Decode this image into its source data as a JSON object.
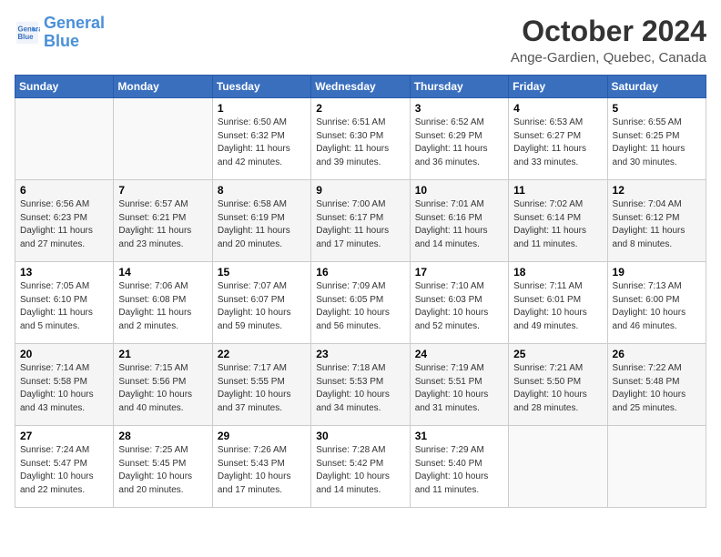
{
  "header": {
    "logo_line1": "General",
    "logo_line2": "Blue",
    "title": "October 2024",
    "subtitle": "Ange-Gardien, Quebec, Canada"
  },
  "days_of_week": [
    "Sunday",
    "Monday",
    "Tuesday",
    "Wednesday",
    "Thursday",
    "Friday",
    "Saturday"
  ],
  "weeks": [
    [
      {
        "day": "",
        "info": ""
      },
      {
        "day": "",
        "info": ""
      },
      {
        "day": "1",
        "info": "Sunrise: 6:50 AM\nSunset: 6:32 PM\nDaylight: 11 hours and 42 minutes."
      },
      {
        "day": "2",
        "info": "Sunrise: 6:51 AM\nSunset: 6:30 PM\nDaylight: 11 hours and 39 minutes."
      },
      {
        "day": "3",
        "info": "Sunrise: 6:52 AM\nSunset: 6:29 PM\nDaylight: 11 hours and 36 minutes."
      },
      {
        "day": "4",
        "info": "Sunrise: 6:53 AM\nSunset: 6:27 PM\nDaylight: 11 hours and 33 minutes."
      },
      {
        "day": "5",
        "info": "Sunrise: 6:55 AM\nSunset: 6:25 PM\nDaylight: 11 hours and 30 minutes."
      }
    ],
    [
      {
        "day": "6",
        "info": "Sunrise: 6:56 AM\nSunset: 6:23 PM\nDaylight: 11 hours and 27 minutes."
      },
      {
        "day": "7",
        "info": "Sunrise: 6:57 AM\nSunset: 6:21 PM\nDaylight: 11 hours and 23 minutes."
      },
      {
        "day": "8",
        "info": "Sunrise: 6:58 AM\nSunset: 6:19 PM\nDaylight: 11 hours and 20 minutes."
      },
      {
        "day": "9",
        "info": "Sunrise: 7:00 AM\nSunset: 6:17 PM\nDaylight: 11 hours and 17 minutes."
      },
      {
        "day": "10",
        "info": "Sunrise: 7:01 AM\nSunset: 6:16 PM\nDaylight: 11 hours and 14 minutes."
      },
      {
        "day": "11",
        "info": "Sunrise: 7:02 AM\nSunset: 6:14 PM\nDaylight: 11 hours and 11 minutes."
      },
      {
        "day": "12",
        "info": "Sunrise: 7:04 AM\nSunset: 6:12 PM\nDaylight: 11 hours and 8 minutes."
      }
    ],
    [
      {
        "day": "13",
        "info": "Sunrise: 7:05 AM\nSunset: 6:10 PM\nDaylight: 11 hours and 5 minutes."
      },
      {
        "day": "14",
        "info": "Sunrise: 7:06 AM\nSunset: 6:08 PM\nDaylight: 11 hours and 2 minutes."
      },
      {
        "day": "15",
        "info": "Sunrise: 7:07 AM\nSunset: 6:07 PM\nDaylight: 10 hours and 59 minutes."
      },
      {
        "day": "16",
        "info": "Sunrise: 7:09 AM\nSunset: 6:05 PM\nDaylight: 10 hours and 56 minutes."
      },
      {
        "day": "17",
        "info": "Sunrise: 7:10 AM\nSunset: 6:03 PM\nDaylight: 10 hours and 52 minutes."
      },
      {
        "day": "18",
        "info": "Sunrise: 7:11 AM\nSunset: 6:01 PM\nDaylight: 10 hours and 49 minutes."
      },
      {
        "day": "19",
        "info": "Sunrise: 7:13 AM\nSunset: 6:00 PM\nDaylight: 10 hours and 46 minutes."
      }
    ],
    [
      {
        "day": "20",
        "info": "Sunrise: 7:14 AM\nSunset: 5:58 PM\nDaylight: 10 hours and 43 minutes."
      },
      {
        "day": "21",
        "info": "Sunrise: 7:15 AM\nSunset: 5:56 PM\nDaylight: 10 hours and 40 minutes."
      },
      {
        "day": "22",
        "info": "Sunrise: 7:17 AM\nSunset: 5:55 PM\nDaylight: 10 hours and 37 minutes."
      },
      {
        "day": "23",
        "info": "Sunrise: 7:18 AM\nSunset: 5:53 PM\nDaylight: 10 hours and 34 minutes."
      },
      {
        "day": "24",
        "info": "Sunrise: 7:19 AM\nSunset: 5:51 PM\nDaylight: 10 hours and 31 minutes."
      },
      {
        "day": "25",
        "info": "Sunrise: 7:21 AM\nSunset: 5:50 PM\nDaylight: 10 hours and 28 minutes."
      },
      {
        "day": "26",
        "info": "Sunrise: 7:22 AM\nSunset: 5:48 PM\nDaylight: 10 hours and 25 minutes."
      }
    ],
    [
      {
        "day": "27",
        "info": "Sunrise: 7:24 AM\nSunset: 5:47 PM\nDaylight: 10 hours and 22 minutes."
      },
      {
        "day": "28",
        "info": "Sunrise: 7:25 AM\nSunset: 5:45 PM\nDaylight: 10 hours and 20 minutes."
      },
      {
        "day": "29",
        "info": "Sunrise: 7:26 AM\nSunset: 5:43 PM\nDaylight: 10 hours and 17 minutes."
      },
      {
        "day": "30",
        "info": "Sunrise: 7:28 AM\nSunset: 5:42 PM\nDaylight: 10 hours and 14 minutes."
      },
      {
        "day": "31",
        "info": "Sunrise: 7:29 AM\nSunset: 5:40 PM\nDaylight: 10 hours and 11 minutes."
      },
      {
        "day": "",
        "info": ""
      },
      {
        "day": "",
        "info": ""
      }
    ]
  ]
}
